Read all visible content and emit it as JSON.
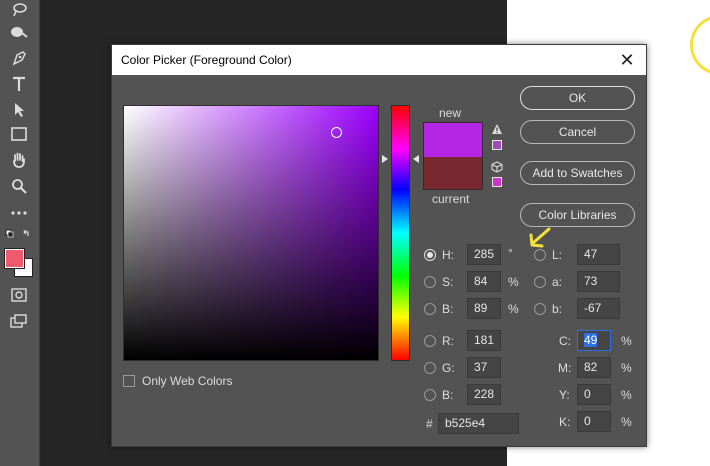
{
  "dialog": {
    "title": "Color Picker (Foreground Color)",
    "close_label": "✕"
  },
  "swatches": {
    "new_label": "new",
    "current_label": "current",
    "new_color": "#b525e4",
    "current_color": "#7a2830"
  },
  "buttons": {
    "ok": "OK",
    "cancel": "Cancel",
    "add_to_swatches": "Add to Swatches",
    "color_libraries": "Color Libraries"
  },
  "web_colors": {
    "label": "Only Web Colors",
    "checked": false
  },
  "hsb": {
    "h": {
      "label": "H:",
      "value": "285",
      "unit": "°",
      "selected": true
    },
    "s": {
      "label": "S:",
      "value": "84",
      "unit": "%"
    },
    "b": {
      "label": "B:",
      "value": "89",
      "unit": "%"
    }
  },
  "rgb": {
    "r": {
      "label": "R:",
      "value": "181"
    },
    "g": {
      "label": "G:",
      "value": "37"
    },
    "b": {
      "label": "B:",
      "value": "228"
    }
  },
  "lab": {
    "l": {
      "label": "L:",
      "value": "47"
    },
    "a": {
      "label": "a:",
      "value": "73"
    },
    "b": {
      "label": "b:",
      "value": "-67"
    }
  },
  "cmyk": {
    "c": {
      "label": "C:",
      "value": "49",
      "unit": "%"
    },
    "m": {
      "label": "M:",
      "value": "82",
      "unit": "%"
    },
    "y": {
      "label": "Y:",
      "value": "0",
      "unit": "%"
    },
    "k": {
      "label": "K:",
      "value": "0",
      "unit": "%"
    }
  },
  "hex": {
    "label": "#",
    "value": "b525e4"
  },
  "colors": {
    "dialog_bg": "#535353",
    "annotation": "#f3e03b",
    "foreground_swatch": "#f05a6e"
  },
  "toolbar_icons": [
    "lasso-icon",
    "healing-icon",
    "pen-icon",
    "type-icon",
    "path-select-icon",
    "rectangle-icon",
    "hand-icon",
    "zoom-icon",
    "more-icon",
    "swap-colors-icon",
    "quick-mask-icon",
    "screen-mode-icon"
  ]
}
